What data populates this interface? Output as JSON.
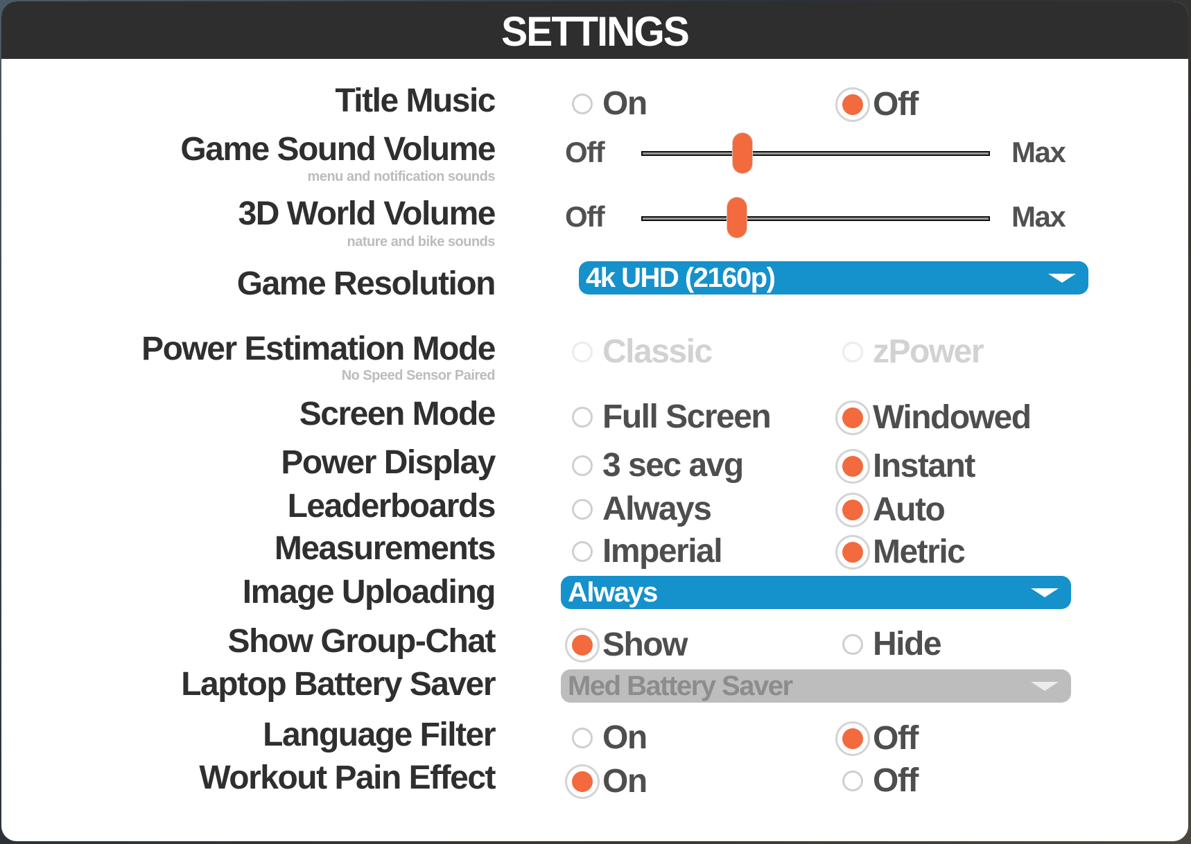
{
  "header": {
    "title": "SETTINGS"
  },
  "colors": {
    "accent": "#f26a3d",
    "dropdown": "#1591cc",
    "header_bg": "#2e2e2e",
    "disabled": "#bdbdbd"
  },
  "settings": {
    "title_music": {
      "label": "Title Music",
      "options": [
        {
          "label": "On",
          "selected": false
        },
        {
          "label": "Off",
          "selected": true
        }
      ]
    },
    "game_sound_volume": {
      "label": "Game Sound Volume",
      "sublabel": "menu and notification sounds",
      "min_label": "Off",
      "max_label": "Max",
      "value_fraction": 0.29
    },
    "world_volume": {
      "label": "3D World Volume",
      "sublabel": "nature and bike sounds",
      "min_label": "Off",
      "max_label": "Max",
      "value_fraction": 0.275
    },
    "game_resolution": {
      "label": "Game Resolution",
      "value": "4k UHD (2160p)"
    },
    "power_estimation_mode": {
      "label": "Power Estimation Mode",
      "sublabel": "No Speed Sensor Paired",
      "disabled": true,
      "options": [
        {
          "label": "Classic",
          "selected": false
        },
        {
          "label": "zPower",
          "selected": false
        }
      ]
    },
    "screen_mode": {
      "label": "Screen Mode",
      "options": [
        {
          "label": "Full Screen",
          "selected": false
        },
        {
          "label": "Windowed",
          "selected": true
        }
      ]
    },
    "power_display": {
      "label": "Power Display",
      "options": [
        {
          "label": "3 sec avg",
          "selected": false
        },
        {
          "label": "Instant",
          "selected": true
        }
      ]
    },
    "leaderboards": {
      "label": "Leaderboards",
      "options": [
        {
          "label": "Always",
          "selected": false
        },
        {
          "label": "Auto",
          "selected": true
        }
      ]
    },
    "measurements": {
      "label": "Measurements",
      "options": [
        {
          "label": "Imperial",
          "selected": false
        },
        {
          "label": "Metric",
          "selected": true
        }
      ]
    },
    "image_uploading": {
      "label": "Image Uploading",
      "value": "Always"
    },
    "show_group_chat": {
      "label": "Show Group-Chat",
      "options": [
        {
          "label": "Show",
          "selected": true
        },
        {
          "label": "Hide",
          "selected": false
        }
      ]
    },
    "laptop_battery_saver": {
      "label": "Laptop Battery Saver",
      "value": "Med Battery Saver",
      "disabled": true
    },
    "language_filter": {
      "label": "Language Filter",
      "options": [
        {
          "label": "On",
          "selected": false
        },
        {
          "label": "Off",
          "selected": true
        }
      ]
    },
    "workout_pain_effect": {
      "label": "Workout Pain Effect",
      "options": [
        {
          "label": "On",
          "selected": true
        },
        {
          "label": "Off",
          "selected": false
        }
      ]
    }
  }
}
